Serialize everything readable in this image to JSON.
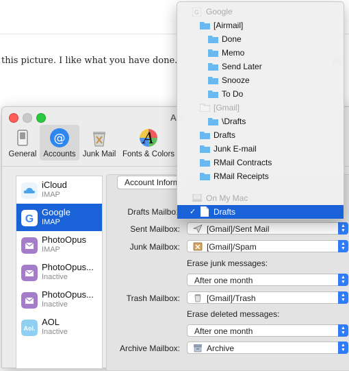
{
  "background": {
    "text_left": "this picture. I like what you have done.",
    "text_right": "at"
  },
  "window": {
    "title": "Acc",
    "colors": {
      "close": "#fc5f57",
      "minimize": "#fdbc2e",
      "zoom": "#29c940",
      "accent": "#1a62d8"
    }
  },
  "toolbar": {
    "items": [
      {
        "label": "General",
        "icon": "general-switch-icon"
      },
      {
        "label": "Accounts",
        "icon": "at-sign-icon"
      },
      {
        "label": "Junk Mail",
        "icon": "junk-trash-icon"
      },
      {
        "label": "Fonts & Colors",
        "icon": "fonts-colors-icon"
      }
    ]
  },
  "accounts": [
    {
      "name": "iCloud",
      "sub": "IMAP",
      "icon": "icloud-icon"
    },
    {
      "name": "Google",
      "sub": "IMAP",
      "icon": "google-icon",
      "selected": true
    },
    {
      "name": "PhotoOpus",
      "sub": "IMAP",
      "icon": "mail-envelope-icon"
    },
    {
      "name": "PhotoOpus...",
      "sub": "Inactive",
      "icon": "mail-envelope-icon"
    },
    {
      "name": "PhotoOpus...",
      "sub": "Inactive",
      "icon": "mail-envelope-icon"
    },
    {
      "name": "AOL",
      "sub": "Inactive",
      "icon": "aol-icon"
    }
  ],
  "tab": {
    "label": "Account Inform"
  },
  "form": {
    "drafts_label": "Drafts Mailbox",
    "sent_label": "Sent Mailbox:",
    "sent_value": "[Gmail]/Sent Mail",
    "junk_label": "Junk Mailbox:",
    "junk_value": "[Gmail]/Spam",
    "erase_junk_label": "Erase junk messages:",
    "erase_junk_value": "After one month",
    "trash_label": "Trash Mailbox:",
    "trash_value": "[Gmail]/Trash",
    "erase_deleted_label": "Erase deleted messages:",
    "erase_deleted_value": "After one month",
    "archive_label": "Archive Mailbox:",
    "archive_value": "Archive"
  },
  "menu": {
    "items": [
      {
        "label": "Google",
        "header": true
      },
      {
        "label": "[Airmail]"
      },
      {
        "label": "Done"
      },
      {
        "label": "Memo"
      },
      {
        "label": "Send Later"
      },
      {
        "label": "Snooze"
      },
      {
        "label": "To Do"
      },
      {
        "label": "[Gmail]",
        "disabled": true
      },
      {
        "label": "\\Drafts"
      },
      {
        "label": "Drafts"
      },
      {
        "label": "Junk E-mail"
      },
      {
        "label": "RMail Contracts"
      },
      {
        "label": "RMail Receipts"
      },
      {
        "label": "On My Mac",
        "header": true
      },
      {
        "label": "Drafts",
        "selected": true
      }
    ],
    "checkmark": "✓"
  }
}
